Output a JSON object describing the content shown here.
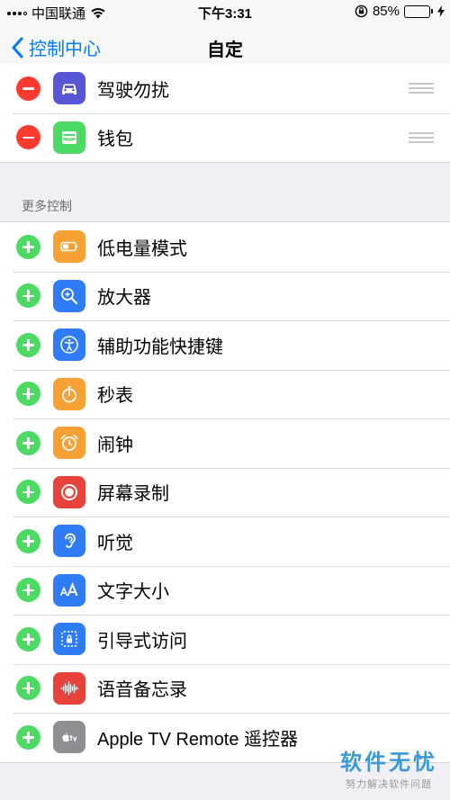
{
  "status_bar": {
    "carrier": "中国联通",
    "time": "下午3:31",
    "battery_percent": "85%",
    "battery_level": 0.85
  },
  "nav": {
    "back_label": "控制中心",
    "title": "自定"
  },
  "included": {
    "items": [
      {
        "label": "驾驶勿扰",
        "icon": "car-icon",
        "color": "#5856d6"
      },
      {
        "label": "钱包",
        "icon": "wallet-icon",
        "color": "#4cd964"
      }
    ]
  },
  "more": {
    "header": "更多控制",
    "items": [
      {
        "label": "低电量模式",
        "icon": "battery-icon",
        "color": "#f7a033"
      },
      {
        "label": "放大器",
        "icon": "magnifier-icon",
        "color": "#2f7cf6"
      },
      {
        "label": "辅助功能快捷键",
        "icon": "accessibility-icon",
        "color": "#2f7cf6"
      },
      {
        "label": "秒表",
        "icon": "stopwatch-icon",
        "color": "#f7a033"
      },
      {
        "label": "闹钟",
        "icon": "alarm-icon",
        "color": "#f7a033"
      },
      {
        "label": "屏幕录制",
        "icon": "record-icon",
        "color": "#e8433a"
      },
      {
        "label": "听觉",
        "icon": "ear-icon",
        "color": "#2f7cf6"
      },
      {
        "label": "文字大小",
        "icon": "text-size-icon",
        "color": "#2f7cf6"
      },
      {
        "label": "引导式访问",
        "icon": "guided-access-icon",
        "color": "#2f7cf6"
      },
      {
        "label": "语音备忘录",
        "icon": "voice-memo-icon",
        "color": "#e8433a"
      },
      {
        "label": "Apple TV Remote 遥控器",
        "icon": "apple-tv-icon",
        "color": "#8e8e93"
      }
    ]
  },
  "watermark": {
    "main": "软件无忧",
    "sub": "努力解决软件问题"
  }
}
